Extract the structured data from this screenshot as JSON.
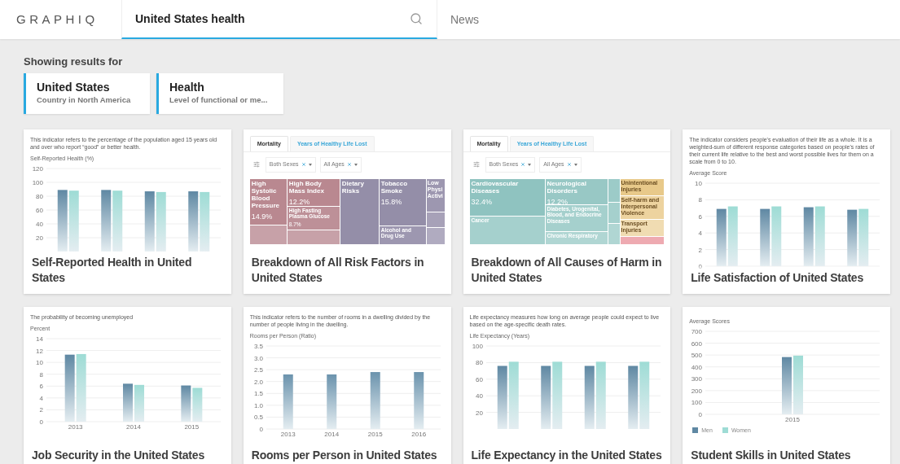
{
  "header": {
    "logo": "GRAPHIQ",
    "search": {
      "value": "United States health"
    },
    "nav": [
      "News"
    ]
  },
  "results_heading": "Showing results for",
  "entities": [
    {
      "name": "United States",
      "description": "Country in North America"
    },
    {
      "name": "Health",
      "description": "Level of functional or me..."
    }
  ],
  "cards": [
    {
      "kind": "bar",
      "description": "This indicator refers to the percentage of the population aged 15 years old and over who report “good” or better health.",
      "axis_label": "Self-Reported Health (%)",
      "title": "Self-Reported Health in United States",
      "chart_data": {
        "type": "bar",
        "grid": true,
        "ylim": [
          0,
          120
        ],
        "yticks": [
          20,
          40,
          60,
          80,
          100,
          120
        ],
        "series": [
          {
            "color": "#5f88a3",
            "values": [
              89,
              89,
              87,
              87
            ]
          },
          {
            "color": "#9edcd5",
            "values": [
              88,
              88,
              86,
              86
            ]
          }
        ]
      }
    },
    {
      "kind": "treemap",
      "title": "Breakdown of All Risk Factors in United States",
      "tabs": [
        {
          "label": "Mortality",
          "selected": true
        },
        {
          "label": "Years of Healthy Life Lost",
          "selected": false
        }
      ],
      "filters": [
        "Both Sexes",
        "All Ages"
      ],
      "columns": [
        {
          "tiles": [
            {
              "label": "High Systolic Blood Pressure",
              "value": "14.9%",
              "color": "#b98890"
            },
            {
              "color": "#c7a1a8"
            }
          ]
        },
        {
          "tiles": [
            {
              "label": "High Body Mass Index",
              "value": "12.2%",
              "color": "#b98890"
            },
            {
              "label": "High Fasting Plasma Glucose",
              "value": "8.7%",
              "color": "#bd9098"
            },
            {
              "color": "#c7a1a8"
            }
          ]
        },
        {
          "tiles": [
            {
              "label": "Dietary Risks",
              "color": "#948ea8"
            }
          ]
        },
        {
          "tiles": [
            {
              "label": "Tobacco Smoke",
              "value": "15.8%",
              "color": "#948ea8"
            },
            {
              "label": "Alcohol and Drug Use",
              "color": "#9d97b0"
            }
          ]
        },
        {
          "tiles": [
            {
              "label": "Low Physi Activi",
              "color": "#9d97b0"
            },
            {
              "color": "#a7a1b8"
            },
            {
              "color": "#b0abc0"
            }
          ]
        }
      ]
    },
    {
      "kind": "treemap",
      "title": "Breakdown of All Causes of Harm in United States",
      "tabs": [
        {
          "label": "Mortality",
          "selected": true
        },
        {
          "label": "Years of Healthy Life Lost",
          "selected": false
        }
      ],
      "filters": [
        "Both Sexes",
        "All Ages"
      ],
      "columns": [
        {
          "tiles": [
            {
              "label": "Cardiovascular Diseases",
              "value": "32.4%",
              "color": "#8fc3c0"
            },
            {
              "label": "Cancer",
              "color": "#a5d0cd"
            }
          ]
        },
        {
          "tiles": [
            {
              "label": "Neurological Disorders",
              "value": "12.2%",
              "color": "#98c8c5"
            },
            {
              "label": "Diabetes, Urogenital, Blood, and Endocrine Diseases",
              "color": "#a5d0cd"
            },
            {
              "label": "Chronic Respiratory",
              "color": "#b0d6d3"
            }
          ]
        },
        {
          "tiles": [
            {
              "color": "#9ccbc8"
            },
            {
              "color": "#a5d0cd"
            },
            {
              "color": "#b0d6d3"
            }
          ]
        },
        {
          "tiles": [
            {
              "label": "Unintentional Injuries",
              "color": "#e8c98a"
            },
            {
              "label": "Self-harm and Interpersonal Violence",
              "color": "#edd39f"
            },
            {
              "label": "Transport Injuries",
              "color": "#f0dcb2"
            },
            {
              "color": "#eeaab1"
            }
          ]
        }
      ]
    },
    {
      "kind": "bar",
      "description": "The indicator considers people's evaluation of their life as a whole. It is a weighted-sum of different response categories based on people's rates of their current life relative to the best and worst possible lives for them on a scale from 0 to 10.",
      "axis_label": "Average Score",
      "title": "Life Satisfaction of United States",
      "chart_data": {
        "type": "bar",
        "grid": true,
        "ylim": [
          0,
          10
        ],
        "yticks": [
          0,
          2,
          4,
          6,
          8,
          10
        ],
        "series": [
          {
            "color": "#5f88a3",
            "values": [
              6.9,
              6.9,
              7.1,
              6.8
            ]
          },
          {
            "color": "#9edcd5",
            "values": [
              7.2,
              7.2,
              7.2,
              6.9
            ]
          }
        ]
      }
    },
    {
      "kind": "bar",
      "description": "The probability of becoming unemployed",
      "axis_label": "Percent",
      "title": "Job Security in the United States",
      "chart_data": {
        "type": "bar",
        "grid": true,
        "categories": [
          "2013",
          "2014",
          "2015"
        ],
        "ylim": [
          0,
          14
        ],
        "yticks": [
          0,
          2,
          4,
          6,
          8,
          10,
          12,
          14
        ],
        "series": [
          {
            "color": "#5f88a3",
            "values": [
              11.3,
              6.4,
              6.1
            ]
          },
          {
            "color": "#9edcd5",
            "values": [
              11.4,
              6.2,
              5.7
            ]
          }
        ]
      }
    },
    {
      "kind": "bar",
      "description": "This indicator refers to the number of rooms in a dwelling divided by the number of people living in the dwelling.",
      "axis_label": "Rooms per Person (Ratio)",
      "title": "Rooms per Person in United States",
      "chart_data": {
        "type": "bar",
        "grid": true,
        "categories": [
          "2013",
          "2014",
          "2015",
          "2016"
        ],
        "ylim": [
          0,
          3.5
        ],
        "yticks": [
          0,
          {
            "value": 0.5,
            "label": "0.5"
          },
          {
            "value": 1,
            "label": "1.0"
          },
          {
            "value": 1.5,
            "label": "1.5"
          },
          {
            "value": 2,
            "label": "2.0"
          },
          {
            "value": 2.5,
            "label": "2.5"
          },
          {
            "value": 3,
            "label": "3.0"
          },
          {
            "value": 3.5,
            "label": "3.5"
          }
        ],
        "series": [
          {
            "color": "#6b93ad",
            "values": [
              2.3,
              2.3,
              2.4,
              2.4
            ]
          }
        ]
      }
    },
    {
      "kind": "bar",
      "description": "Life expectancy measures how long on average people could expect to live based on the age-specific death rates.",
      "axis_label": "Life Expectancy (Years)",
      "title": "Life Expectancy in the United States",
      "chart_data": {
        "type": "bar",
        "grid": true,
        "ylim": [
          0,
          100
        ],
        "yticks": [
          20,
          40,
          60,
          80,
          100
        ],
        "series": [
          {
            "color": "#5f88a3",
            "values": [
              76,
              76,
              76,
              76
            ]
          },
          {
            "color": "#9edcd5",
            "values": [
              81,
              81,
              81,
              81
            ]
          }
        ]
      }
    },
    {
      "kind": "bar",
      "axis_label": "Average Scores",
      "title": "Student Skills in United States",
      "chart_data": {
        "type": "bar",
        "grid": true,
        "legend": "bottom",
        "categories": [
          "2015"
        ],
        "ylim": [
          0,
          700
        ],
        "yticks": [
          0,
          100,
          200,
          300,
          400,
          500,
          600,
          700
        ],
        "series": [
          {
            "name": "Men",
            "color": "#5f88a3",
            "values": [
              483
            ]
          },
          {
            "name": "Women",
            "color": "#9edcd5",
            "values": [
              495
            ]
          }
        ]
      }
    }
  ]
}
